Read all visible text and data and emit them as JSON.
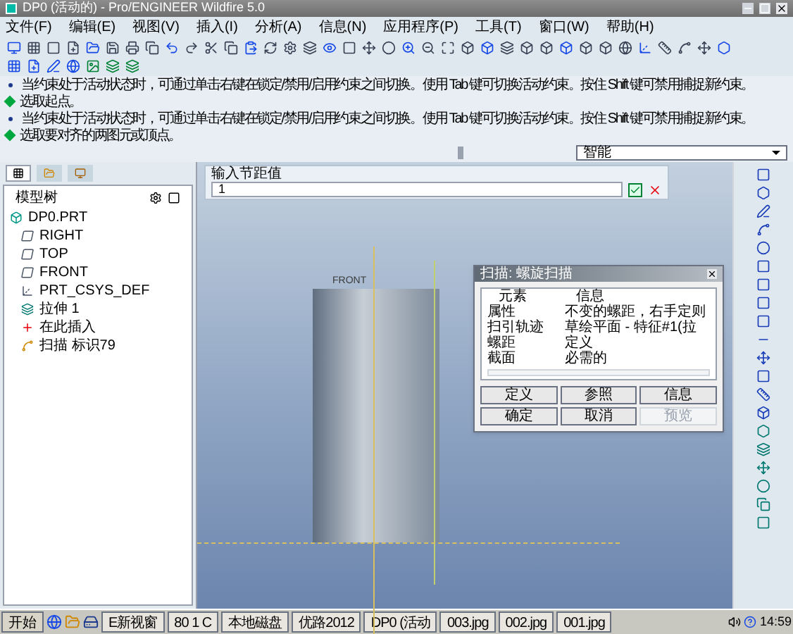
{
  "window": {
    "title": "DP0 (活动的) - Pro/ENGINEER Wildfire 5.0"
  },
  "menu": [
    "文件(F)",
    "编辑(E)",
    "视图(V)",
    "插入(I)",
    "分析(A)",
    "信息(N)",
    "应用程序(P)",
    "工具(T)",
    "窗口(W)",
    "帮助(H)"
  ],
  "messages": [
    {
      "kind": "info",
      "text": "当约束处于活动状态时，可通过单击右键在锁定/禁用/启用约束之间切换。使用 Tab 键可切换活动约束。按住 Shift 键可禁用捕捉新约束。"
    },
    {
      "kind": "prompt",
      "text": "选取起点。"
    },
    {
      "kind": "info",
      "text": "当约束处于活动状态时，可通过单击右键在锁定/禁用/启用约束之间切换。使用 Tab 键可切换活动约束。按住 Shift 键可禁用捕捉新约束。"
    },
    {
      "kind": "prompt",
      "text": "选取要对齐的两图元或顶点。"
    }
  ],
  "filter": {
    "value": "智能"
  },
  "tree_tabs": [
    {
      "selected": true
    },
    {
      "selected": false
    },
    {
      "selected": false
    }
  ],
  "model_tree": {
    "title": "模型树",
    "items": [
      {
        "kind": "part",
        "label": "DP0.PRT",
        "children": [
          {
            "kind": "plane",
            "label": "RIGHT"
          },
          {
            "kind": "plane",
            "label": "TOP"
          },
          {
            "kind": "plane",
            "label": "FRONT"
          },
          {
            "kind": "csys",
            "label": "PRT_CSYS_DEF"
          },
          {
            "kind": "feature",
            "label": "拉伸 1"
          },
          {
            "kind": "insert",
            "label": "在此插入"
          },
          {
            "kind": "sweep",
            "label": "扫描 标识79"
          }
        ]
      }
    ]
  },
  "input_bar": {
    "label": "输入节距值",
    "value": "1"
  },
  "graphics": {
    "datum_label": "FRONT"
  },
  "dialog": {
    "title": "扫描: 螺旋扫描",
    "columns": [
      "元素",
      "信息"
    ],
    "rows": [
      {
        "element": "属性",
        "info": "不变的螺距，右手定则"
      },
      {
        "element": "扫引轨迹",
        "info": "草绘平面 - 特征#1(拉"
      },
      {
        "element": "螺距",
        "info": "定义"
      },
      {
        "element": "截面",
        "info": "必需的"
      }
    ],
    "buttons": [
      {
        "label": "定义",
        "disabled": false
      },
      {
        "label": "参照",
        "disabled": false
      },
      {
        "label": "信息",
        "disabled": false
      },
      {
        "label": "确定",
        "disabled": false
      },
      {
        "label": "取消",
        "disabled": false
      },
      {
        "label": "预览",
        "disabled": true
      }
    ]
  },
  "taskbar": {
    "start": "开始",
    "items": [
      "E新视窗",
      "80 1 C",
      "本地磁盘",
      "优路2012",
      "DP0 (活动",
      "003.jpg",
      "002.jpg",
      "001.jpg"
    ],
    "clock": "14:59"
  }
}
